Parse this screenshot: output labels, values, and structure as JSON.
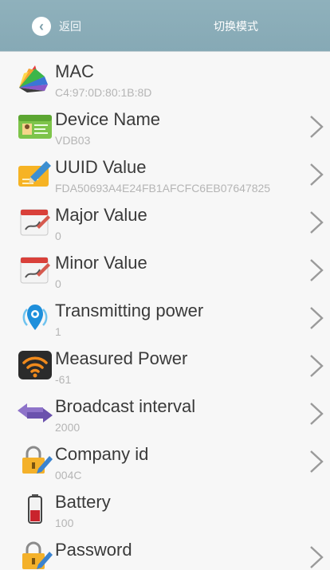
{
  "header": {
    "back_label": "返回",
    "title": "切换模式"
  },
  "items": [
    {
      "label": "MAC",
      "value": "C4:97:0D:80:1B:8D",
      "icon": "rainbow-fan-icon",
      "has_chevron": false
    },
    {
      "label": "Device Name",
      "value": "VDB03",
      "icon": "id-card-icon",
      "has_chevron": true
    },
    {
      "label": "UUID Value",
      "value": "FDA50693A4E24FB1AFCFC6EB07647825",
      "icon": "pencil-card-icon",
      "has_chevron": true
    },
    {
      "label": "Major Value",
      "value": "0",
      "icon": "calendar-pen-icon",
      "has_chevron": true
    },
    {
      "label": "Minor Value",
      "value": "0",
      "icon": "calendar-pen-icon",
      "has_chevron": true
    },
    {
      "label": "Transmitting power",
      "value": "1",
      "icon": "beacon-icon",
      "has_chevron": true
    },
    {
      "label": "Measured Power",
      "value": "-61",
      "icon": "wifi-icon",
      "has_chevron": true
    },
    {
      "label": "Broadcast interval",
      "value": "2000",
      "icon": "double-arrow-icon",
      "has_chevron": true
    },
    {
      "label": "Company id",
      "value": "004C",
      "icon": "lock-edit-icon",
      "has_chevron": true
    },
    {
      "label": "Battery",
      "value": "100",
      "icon": "battery-icon",
      "has_chevron": false
    },
    {
      "label": "Password",
      "value": "····",
      "icon": "lock-edit-icon",
      "has_chevron": true
    }
  ],
  "colors": {
    "header_bg": "#8fb1bc",
    "label": "#3a3a3a",
    "value": "#b5b5b5",
    "chevron": "#9a9a9a"
  }
}
